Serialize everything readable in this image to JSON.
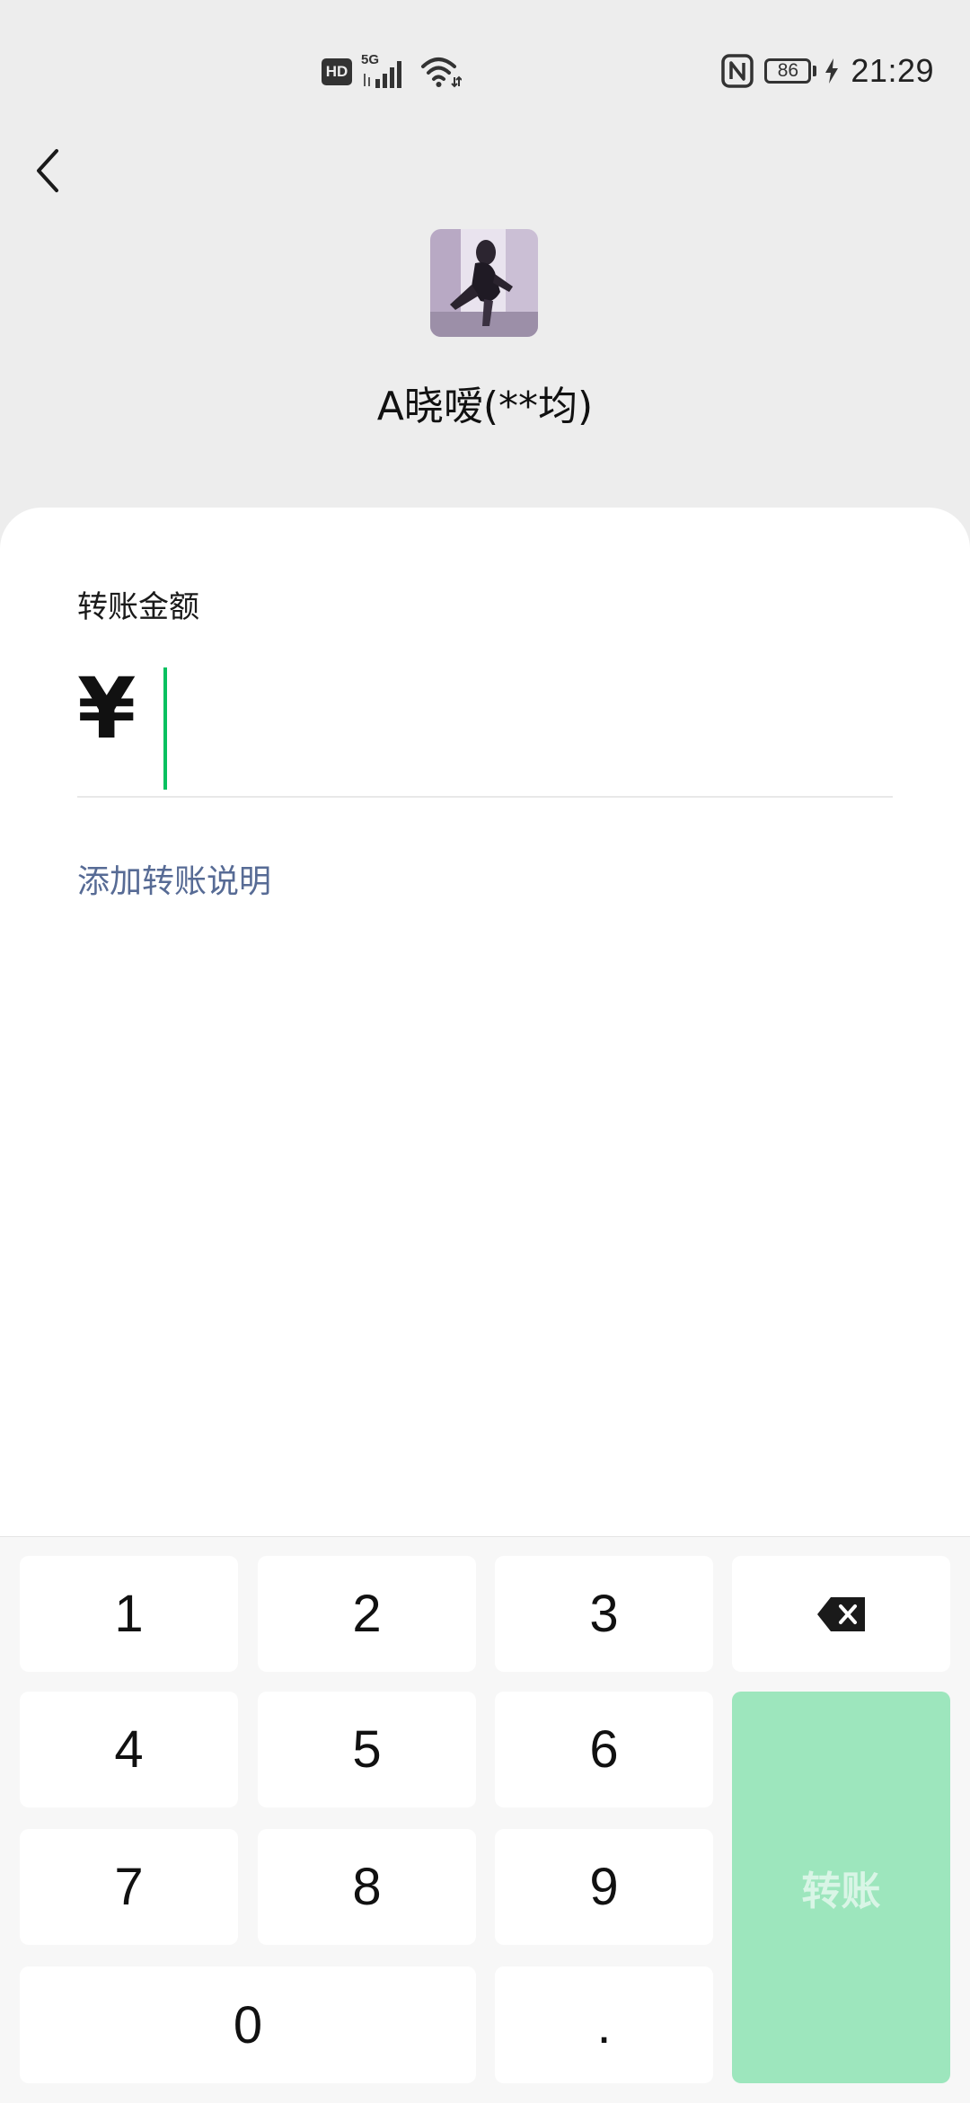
{
  "status_bar": {
    "hd_label": "HD",
    "network_label": "5G",
    "battery_level": "86",
    "time": "21:29"
  },
  "header": {
    "back_icon": "chevron-left-icon",
    "contact_name": "A晓嗳(**均)"
  },
  "transfer_form": {
    "amount_label": "转账金额",
    "currency_symbol": "¥",
    "amount_value": "",
    "add_note_link": "添加转账说明"
  },
  "keypad": {
    "keys": {
      "k1": "1",
      "k2": "2",
      "k3": "3",
      "k4": "4",
      "k5": "5",
      "k6": "6",
      "k7": "7",
      "k8": "8",
      "k9": "9",
      "k0": "0",
      "dot": "."
    },
    "backspace_icon": "backspace-icon",
    "transfer_button": "转账"
  },
  "colors": {
    "accent_green": "#07c160",
    "transfer_disabled": "#9de6bd",
    "link_blue": "#576b95",
    "header_bg": "#ededed"
  }
}
